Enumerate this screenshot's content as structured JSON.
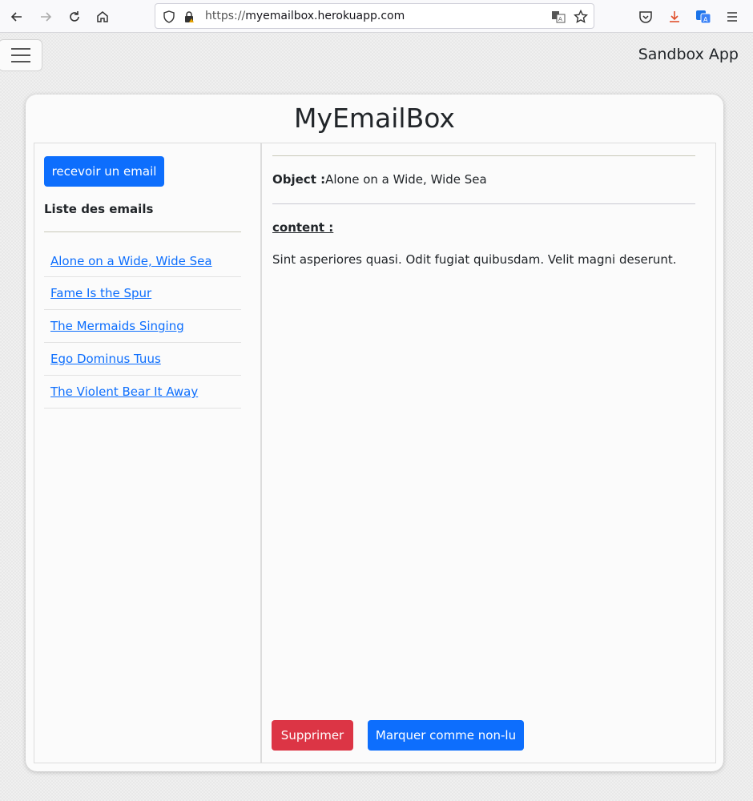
{
  "browser": {
    "url_scheme": "https://",
    "url_host": "myemailbox.herokuapp.com",
    "icons": [
      "back-icon",
      "forward-icon",
      "reload-icon",
      "home-icon",
      "shield-icon",
      "lock-icon",
      "translate-icon",
      "bookmark-star-icon",
      "pocket-icon",
      "download-icon",
      "extension-icon",
      "menu-icon"
    ]
  },
  "navbar": {
    "brand": "Sandbox App"
  },
  "app": {
    "title": "MyEmailBox"
  },
  "sidebar": {
    "receive_button": "recevoir un email",
    "list_title": "Liste des emails",
    "emails": [
      "Alone on a Wide, Wide Sea",
      "Fame Is the Spur",
      "The Mermaids Singing",
      "Ego Dominus Tuus",
      "The Violent Bear It Away"
    ]
  },
  "detail": {
    "object_label": "Object :",
    "object_value": "Alone on a Wide, Wide Sea",
    "content_label": "content :",
    "content_value": "Sint asperiores quasi. Odit fugiat quibusdam. Velit magni deserunt.",
    "delete_button": "Supprimer",
    "mark_unread_button": "Marquer comme non-lu"
  },
  "colors": {
    "primary": "#0d6efd",
    "danger": "#dc3545"
  }
}
